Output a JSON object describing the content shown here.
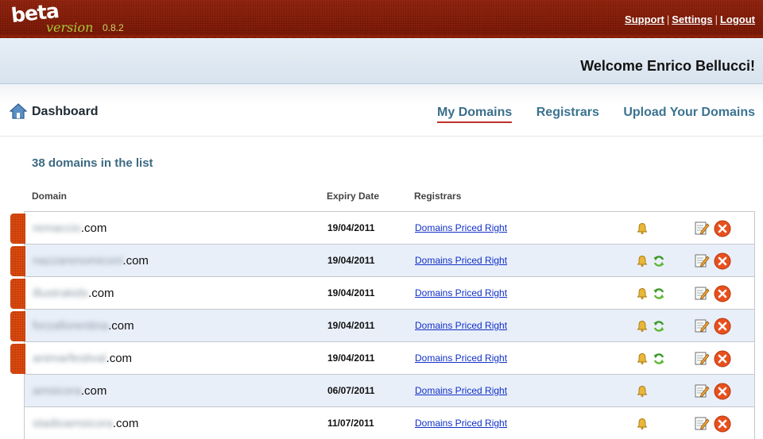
{
  "header": {
    "logo_beta": "beta",
    "logo_version": "version",
    "logo_version_number": "0.8.2",
    "links": [
      {
        "label": "Support"
      },
      {
        "label": "Settings"
      },
      {
        "label": "Logout"
      }
    ],
    "separator": "|"
  },
  "welcome": {
    "text": "Welcome Enrico Bellucci!"
  },
  "nav": {
    "dashboard_label": "Dashboard",
    "tabs": [
      {
        "label": "My Domains",
        "active": true
      },
      {
        "label": "Registrars",
        "active": false
      },
      {
        "label": "Upload Your Domains",
        "active": false
      }
    ]
  },
  "list": {
    "count_text": "38 domains in the list",
    "columns": {
      "domain": "Domain",
      "expiry": "Expiry Date",
      "registrar": "Registrars"
    },
    "rows": [
      {
        "name_blurred": "remaccio",
        "tld": ".com",
        "expiry": "19/04/2011",
        "registrar": "Domains Priced Right",
        "flagged": true,
        "icons": [
          "bell-icon"
        ]
      },
      {
        "name_blurred": "nazzarenomiconi",
        "tld": ".com",
        "expiry": "19/04/2011",
        "registrar": "Domains Priced Right",
        "flagged": true,
        "icons": [
          "bell-icon",
          "renew-icon"
        ]
      },
      {
        "name_blurred": "illustrakids",
        "tld": ".com",
        "expiry": "19/04/2011",
        "registrar": "Domains Priced Right",
        "flagged": true,
        "icons": [
          "bell-icon",
          "renew-icon"
        ]
      },
      {
        "name_blurred": "forzafiorentina",
        "tld": ".com",
        "expiry": "19/04/2011",
        "registrar": "Domains Priced Right",
        "flagged": true,
        "icons": [
          "bell-icon",
          "renew-icon"
        ]
      },
      {
        "name_blurred": "animarfestival",
        "tld": ".com",
        "expiry": "19/04/2011",
        "registrar": "Domains Priced Right",
        "flagged": true,
        "icons": [
          "bell-icon",
          "renew-icon"
        ]
      },
      {
        "name_blurred": "amsicora",
        "tld": ".com",
        "expiry": "06/07/2011",
        "registrar": "Domains Priced Right",
        "flagged": false,
        "icons": [
          "bell-icon"
        ]
      },
      {
        "name_blurred": "stadioamsicora",
        "tld": ".com",
        "expiry": "11/07/2011",
        "registrar": "Domains Priced Right",
        "flagged": false,
        "icons": [
          "bell-icon"
        ]
      }
    ]
  },
  "colors": {
    "header_red": "#8a1f0a",
    "flag_orange": "#e04a0e",
    "link_blue": "#1030c8",
    "tab_blue": "#3b7390",
    "row_alt": "#e9eff9"
  }
}
